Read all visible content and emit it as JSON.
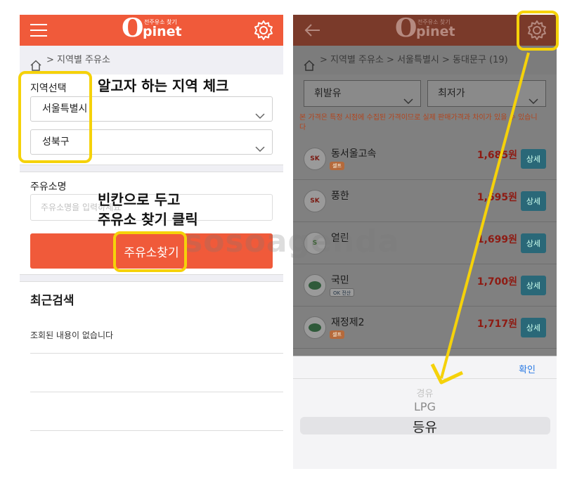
{
  "left": {
    "logo": {
      "letter": "O",
      "word": "pinet",
      "tag": "전주유소 찾기"
    },
    "breadcrumb": "> 지역별 주유소",
    "region_label": "지역선택",
    "region_city": "서울특별시",
    "region_district": "성북구",
    "station_label": "주유소명",
    "station_placeholder": "주유소명을 입력하세요",
    "search_button": "주유소찾기",
    "recent_title": "최근검색",
    "recent_empty": "조회된 내용이 없습니다"
  },
  "annotations": {
    "region_check": "알고자 하는 지역 체크",
    "leave_blank_1": "빈칸으로 두고",
    "leave_blank_2": "주유소 찾기 클릭"
  },
  "watermark": "sosoagenda",
  "right": {
    "breadcrumb": "> 지역별 주유소 > 서울특별시 > 동대문구 (19)",
    "fuel_select": "휘발유",
    "sort_select": "최저가",
    "notice": "본 가격은 특정 시점에 수집된 가격이므로 실제 판매가격과 차이가 있을 수 있습니다",
    "stations": [
      {
        "name": "동서울고속",
        "logo": "SK",
        "badge": "셀프",
        "badge2": "",
        "price": "1,685원",
        "detail": "상세"
      },
      {
        "name": "풍한",
        "logo": "SK",
        "badge": "",
        "badge2": "",
        "price": "1,695원",
        "detail": "상세"
      },
      {
        "name": "열린",
        "logo": "S",
        "badge": "",
        "badge2": "",
        "price": "1,699원",
        "detail": "상세"
      },
      {
        "name": "국민",
        "logo": "",
        "badge": "",
        "badge2": "OK 전산",
        "price": "1,700원",
        "detail": "상세"
      },
      {
        "name": "재정제2",
        "logo": "",
        "badge": "셀프",
        "badge2": "",
        "price": "1,717원",
        "detail": "상세"
      }
    ],
    "picker": {
      "confirm": "확인",
      "options": [
        "경유",
        "LPG",
        "등유"
      ]
    }
  },
  "colors": {
    "brand": "#f05a3a",
    "highlight": "#f5d20a",
    "link": "#2a7ae4"
  }
}
